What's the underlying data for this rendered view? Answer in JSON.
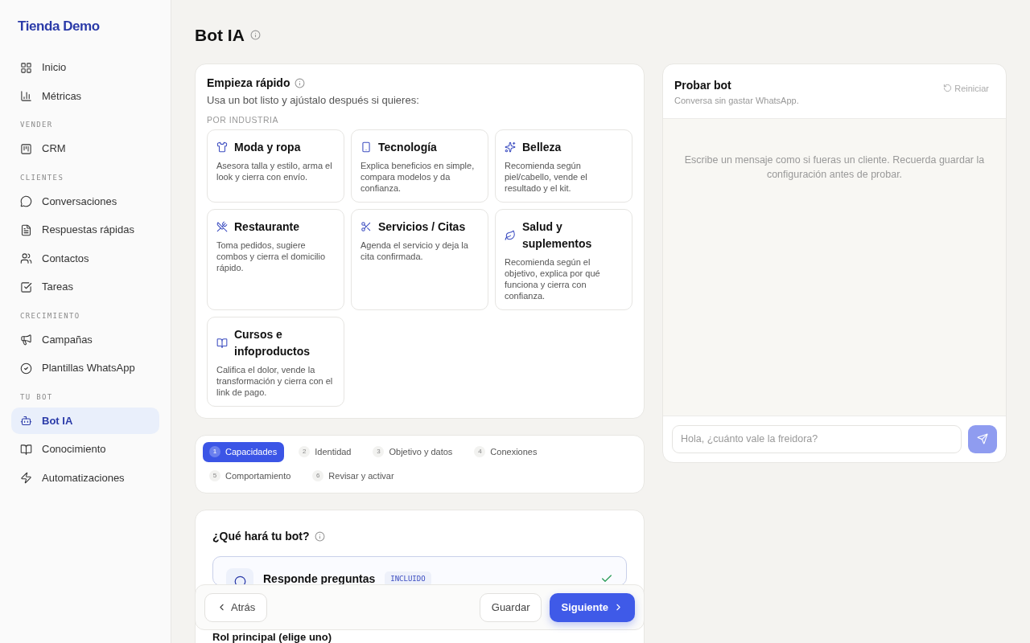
{
  "sidebar": {
    "brand": "Tienda Demo",
    "sections": [
      {
        "items": [
          {
            "label": "Inicio",
            "selected": false
          },
          {
            "label": "Métricas",
            "selected": false
          }
        ]
      },
      {
        "heading": "VENDER",
        "items": [
          {
            "label": "CRM",
            "selected": false
          }
        ]
      },
      {
        "heading": "CLIENTES",
        "items": [
          {
            "label": "Conversaciones",
            "selected": false
          },
          {
            "label": "Respuestas rápidas",
            "selected": false
          },
          {
            "label": "Contactos",
            "selected": false
          },
          {
            "label": "Tareas",
            "selected": false
          }
        ]
      },
      {
        "heading": "CRECIMIENTO",
        "items": [
          {
            "label": "Campañas",
            "selected": false
          },
          {
            "label": "Plantillas WhatsApp",
            "selected": false
          }
        ]
      },
      {
        "heading": "TU BOT",
        "items": [
          {
            "label": "Bot IA",
            "selected": true
          },
          {
            "label": "Conocimiento",
            "selected": false
          },
          {
            "label": "Automatizaciones",
            "selected": false
          }
        ]
      }
    ]
  },
  "page_title": "Bot IA",
  "quick_start": {
    "title": "Empieza rápido",
    "subtitle": "Usa un bot listo y ajústalo después si quieres:",
    "group_label": "POR INDUSTRIA",
    "templates": [
      {
        "title": "Moda y ropa",
        "description": "Asesora talla y estilo, arma el look y cierra con envío."
      },
      {
        "title": "Tecnología",
        "description": "Explica beneficios en simple, compara modelos y da confianza."
      },
      {
        "title": "Belleza",
        "description": "Recomienda según piel/cabello, vende el resultado y el kit."
      },
      {
        "title": "Restaurante",
        "description": "Toma pedidos, sugiere combos y cierra el domicilio rápido."
      },
      {
        "title": "Servicios / Citas",
        "description": "Agenda el servicio y deja la cita confirmada."
      },
      {
        "title": "Salud y suplementos",
        "description": "Recomienda según el objetivo, explica por qué funciona y cierra con confianza."
      },
      {
        "title": "Cursos e infoproductos",
        "description": "Califica el dolor, vende la transformación y cierra con el link de pago."
      }
    ]
  },
  "steps": [
    {
      "number": "1",
      "label": "Capacidades",
      "selected": true
    },
    {
      "number": "2",
      "label": "Identidad",
      "selected": false
    },
    {
      "number": "3",
      "label": "Objetivo y datos",
      "selected": false
    },
    {
      "number": "4",
      "label": "Conexiones",
      "selected": false
    },
    {
      "number": "5",
      "label": "Comportamiento",
      "selected": false
    },
    {
      "number": "6",
      "label": "Revisar y activar",
      "selected": false
    }
  ],
  "capabilities": {
    "title": "¿Qué hará tu bot?",
    "items": [
      {
        "title": "Responde preguntas",
        "badge": "INCLUIDO",
        "checked": true
      }
    ],
    "role_label": "Rol principal (elige uno)"
  },
  "footer": {
    "back": "Atrás",
    "save": "Guardar",
    "next": "Siguiente"
  },
  "test_bot": {
    "title": "Probar bot",
    "subtitle": "Conversa sin gastar WhatsApp.",
    "reset": "Reiniciar",
    "empty_message": "Escribe un mensaje como si fueras un cliente. Recuerda guardar la configuración antes de probar.",
    "input_placeholder": "Hola, ¿cuánto vale la freidora?"
  }
}
